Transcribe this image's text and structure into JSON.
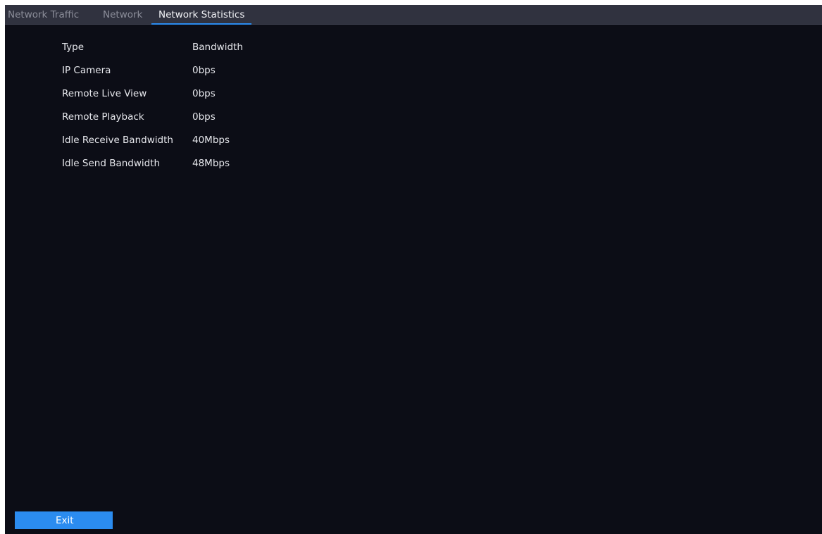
{
  "tabs": [
    {
      "label": "Network Traffic"
    },
    {
      "label": "Network"
    },
    {
      "label": "Network Statistics"
    }
  ],
  "active_tab": "Network Statistics",
  "stats": {
    "header": {
      "type": "Type",
      "value": "Bandwidth"
    },
    "rows": [
      {
        "type": "IP Camera",
        "value": "0bps"
      },
      {
        "type": "Remote Live View",
        "value": "0bps"
      },
      {
        "type": "Remote Playback",
        "value": "0bps"
      },
      {
        "type": "Idle Receive Bandwidth",
        "value": "40Mbps"
      },
      {
        "type": "Idle Send Bandwidth",
        "value": "48Mbps"
      }
    ]
  },
  "footer": {
    "exit_label": "Exit"
  },
  "colors": {
    "background": "#0c0d16",
    "tab_bar": "#30323f",
    "accent": "#2b8cf0",
    "inactive_tab_text": "#8b8d99",
    "text": "#e6e7ec"
  }
}
